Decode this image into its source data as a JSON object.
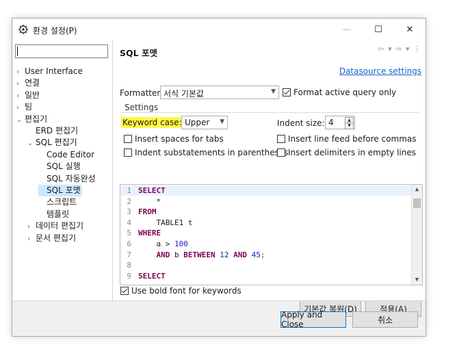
{
  "window": {
    "title": "환경 설정(P)",
    "minimize_glyph": "—",
    "maximize_glyph": "☐",
    "close_glyph": "✕"
  },
  "sidebar": {
    "filter_value": "",
    "items": [
      {
        "label": "User Interface",
        "twisty": "›"
      },
      {
        "label": "연결",
        "twisty": "›"
      },
      {
        "label": "일반",
        "twisty": "›"
      },
      {
        "label": "팀",
        "twisty": "›"
      },
      {
        "label": "편집기",
        "twisty": "⌄"
      },
      {
        "label": "ERD 편집기",
        "twisty": ""
      },
      {
        "label": "SQL 편집기",
        "twisty": "⌄"
      },
      {
        "label": "Code Editor",
        "twisty": ""
      },
      {
        "label": "SQL 실행",
        "twisty": ""
      },
      {
        "label": "SQL 자동완성",
        "twisty": ""
      },
      {
        "label": "SQL 포맷",
        "twisty": "",
        "selected": true
      },
      {
        "label": "스크립트",
        "twisty": ""
      },
      {
        "label": "템플릿",
        "twisty": ""
      },
      {
        "label": "데이터 편집기",
        "twisty": "›"
      },
      {
        "label": "문서 편집기",
        "twisty": "›"
      }
    ]
  },
  "main": {
    "section_title": "SQL 포맷",
    "nav_icons": "⇦ ▾ ⇨ ▾ ⋮",
    "datasource_link": "Datasource settings",
    "formatter_label": "Formatter:",
    "formatter_value": "서식 기본값",
    "format_active_label": "Format active query only",
    "format_active_checked": true,
    "settings_group_label": "Settings",
    "keyword_case_label": "Keyword case:",
    "keyword_case_value": "Upper",
    "indent_size_label": "Indent size:",
    "indent_size_value": "4",
    "options": [
      {
        "label": "Insert spaces for tabs",
        "checked": false
      },
      {
        "label": "Insert line feed before commas",
        "checked": false
      },
      {
        "label": "Indent substatements in parentheses",
        "checked": false
      },
      {
        "label": "Insert delimiters in empty lines",
        "checked": false
      }
    ],
    "code_lines": [
      {
        "n": "1",
        "segments": [
          {
            "t": "SELECT",
            "c": "kw"
          }
        ]
      },
      {
        "n": "2",
        "segments": [
          {
            "t": "    *",
            "c": ""
          }
        ]
      },
      {
        "n": "3",
        "segments": [
          {
            "t": "FROM",
            "c": "kw"
          }
        ]
      },
      {
        "n": "4",
        "segments": [
          {
            "t": "    TABLE1 t",
            "c": ""
          }
        ]
      },
      {
        "n": "5",
        "segments": [
          {
            "t": "WHERE",
            "c": "kw"
          }
        ]
      },
      {
        "n": "6",
        "segments": [
          {
            "t": "    a > ",
            "c": ""
          },
          {
            "t": "100",
            "c": "num"
          }
        ]
      },
      {
        "n": "7",
        "segments": [
          {
            "t": "    ",
            "c": ""
          },
          {
            "t": "AND",
            "c": "kw"
          },
          {
            "t": " b ",
            "c": ""
          },
          {
            "t": "BETWEEN",
            "c": "kw"
          },
          {
            "t": " ",
            "c": ""
          },
          {
            "t": "12",
            "c": "num"
          },
          {
            "t": " ",
            "c": ""
          },
          {
            "t": "AND",
            "c": "kw"
          },
          {
            "t": " ",
            "c": ""
          },
          {
            "t": "45",
            "c": "num"
          },
          {
            "t": ";",
            "c": "pun"
          }
        ]
      },
      {
        "n": "8",
        "segments": []
      },
      {
        "n": "9",
        "segments": [
          {
            "t": "SELECT",
            "c": "kw"
          }
        ]
      }
    ],
    "bold_keywords_label": "Use bold font for keywords",
    "bold_keywords_checked": true,
    "restore_defaults_label": "기본값 복원(D)",
    "apply_label": "적용(A)"
  },
  "footer": {
    "apply_close_label": "Apply and Close",
    "cancel_label": "취소"
  },
  "colors": {
    "highlight": "#fffb46",
    "selection": "#cce8ff",
    "link": "#1a62c8",
    "keyword": "#7f0055",
    "number": "#1a1ac8"
  }
}
